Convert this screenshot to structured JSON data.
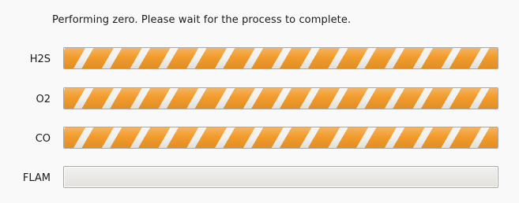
{
  "message": "Performing zero.  Please wait for the process to complete.",
  "sensors": [
    {
      "label": "H2S",
      "progress": 1.0,
      "state": "busy"
    },
    {
      "label": "O2",
      "progress": 1.0,
      "state": "busy"
    },
    {
      "label": "CO",
      "progress": 1.0,
      "state": "busy"
    },
    {
      "label": "FLAM",
      "progress": 0.0,
      "state": "idle"
    }
  ],
  "colors": {
    "stripe": "#f29b2b",
    "stripe_gap": "#f3f2ee",
    "background": "#f9f9f9",
    "bar_border": "#a8a8a8"
  }
}
